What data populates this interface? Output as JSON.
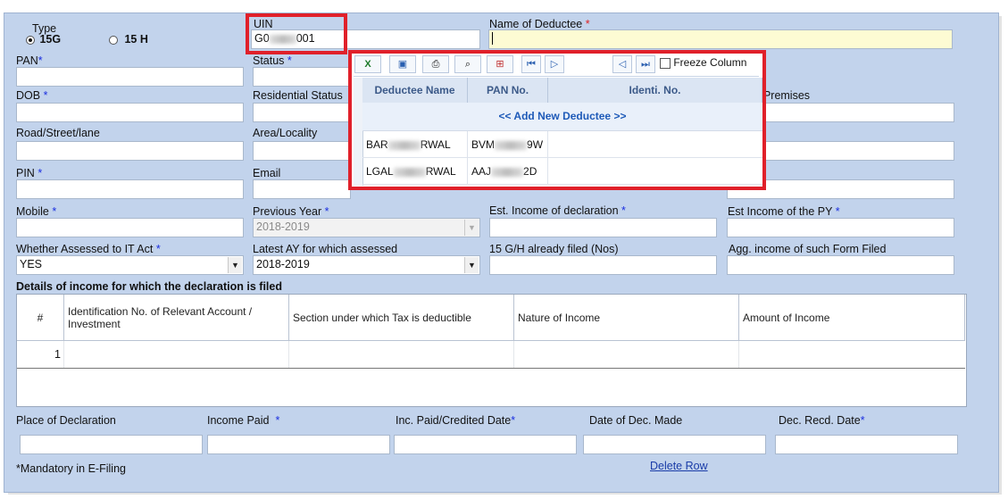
{
  "type_group": {
    "label": "Type",
    "options": [
      {
        "label": "15G",
        "selected": true
      },
      {
        "label": "15 H",
        "selected": false
      }
    ]
  },
  "uin": {
    "label": "UIN",
    "value_prefix": "G0",
    "value_suffix": "001"
  },
  "name_of_deductee": {
    "label": "Name of Deductee",
    "value": ""
  },
  "pan": {
    "label": "PAN"
  },
  "status": {
    "label": "Status"
  },
  "dob": {
    "label": "DOB"
  },
  "residential_status": {
    "label": "Residential Status"
  },
  "premises": {
    "label": "f Premises"
  },
  "road": {
    "label": "Road/Street/lane"
  },
  "area": {
    "label": "Area/Locality"
  },
  "pin": {
    "label": "PIN"
  },
  "email": {
    "label": "Email"
  },
  "mobile": {
    "label": "Mobile"
  },
  "previous_year": {
    "label": "Previous Year",
    "value": "2018-2019"
  },
  "est_income_decl": {
    "label": "Est. Income of declaration"
  },
  "est_income_py": {
    "label": "Est Income of the PY"
  },
  "assessed": {
    "label": "Whether Assessed to IT Act",
    "value": "YES"
  },
  "latest_ay": {
    "label": "Latest AY for which assessed",
    "value": "2018-2019"
  },
  "filed_nos": {
    "label": "15 G/H already filed (Nos)"
  },
  "agg_income": {
    "label": "Agg. income of such Form Filed"
  },
  "details_heading": "Details of income for which the declaration is filed",
  "details_table": {
    "headers": [
      "#",
      "Identification No. of Relevant Account / Investment",
      "Section under which Tax is deductible",
      "Nature of Income",
      "Amount of Income"
    ],
    "rows": [
      {
        "num": "1"
      }
    ]
  },
  "bottom": {
    "place": "Place of Declaration",
    "income_paid": "Income Paid",
    "inc_paid_date": "Inc. Paid/Credited Date",
    "date_dec_made": "Date of Dec. Made",
    "dec_recd_date": "Dec. Recd. Date"
  },
  "mandatory_note": "*Mandatory in E-Filing",
  "delete_row": "Delete Row",
  "popup": {
    "freeze_label": "Freeze Column",
    "headers": [
      "Deductee Name",
      "PAN No.",
      "Identi. No."
    ],
    "add_new": "<< Add New Deductee >>",
    "rows": [
      {
        "name_a": "BAR",
        "name_b": "RWAL",
        "pan_a": "BVM",
        "pan_b": "9W"
      },
      {
        "name_a": "LGAL",
        "name_b": "RWAL",
        "pan_a": "AAJ",
        "pan_b": "2D"
      }
    ],
    "toolbar_icons": [
      "excel-icon",
      "export-icon",
      "print-icon",
      "find-icon",
      "tree-icon",
      "first-icon",
      "next-icon",
      "prev-icon",
      "last-icon"
    ]
  },
  "colors": {
    "panel": "#c2d3ec",
    "highlight": "#e0202a",
    "link": "#1a3ca8",
    "required": "#1a2ee0"
  }
}
